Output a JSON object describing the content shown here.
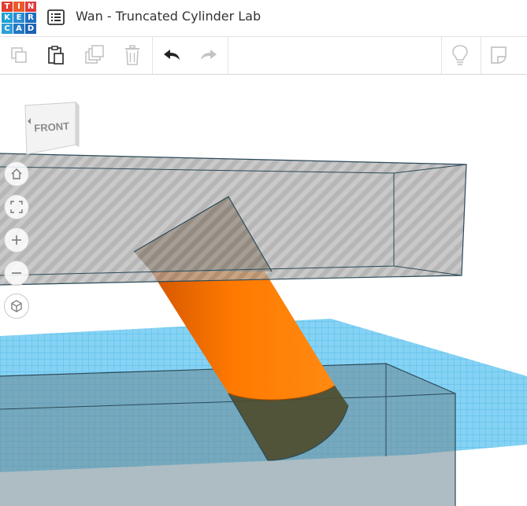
{
  "app": {
    "logo_letters": [
      "T",
      "I",
      "N",
      "K",
      "E",
      "R",
      "C",
      "A",
      "D"
    ],
    "title": "Wan - Truncated Cylinder Lab"
  },
  "toolbar": {
    "tools": [
      {
        "name": "copy-icon"
      },
      {
        "name": "paste-icon"
      },
      {
        "name": "duplicate-icon"
      },
      {
        "name": "delete-icon"
      },
      {
        "name": "undo-icon"
      },
      {
        "name": "redo-icon"
      },
      {
        "name": "lightbulb-icon"
      },
      {
        "name": "notes-icon"
      }
    ]
  },
  "viewcube": {
    "face_label": "FRONT"
  },
  "nav_controls": [
    "home-icon",
    "fit-view-icon",
    "zoom-in-icon",
    "zoom-out-icon",
    "ortho-view-icon"
  ],
  "colors": {
    "cylinder": "#ff7700",
    "hole": "#8a8a8a",
    "grid": "#49b9e8"
  }
}
